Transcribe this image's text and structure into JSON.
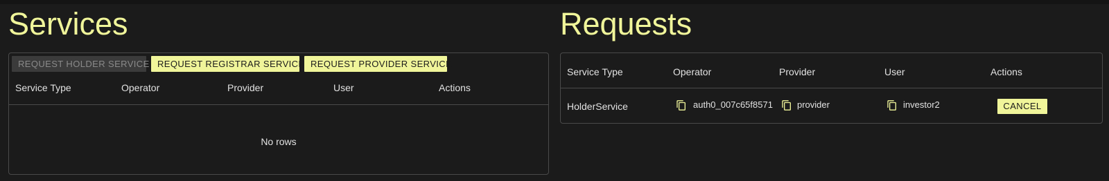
{
  "services": {
    "title": "Services",
    "buttons": {
      "holder": "REQUEST HOLDER SERVICE",
      "registrar": "REQUEST REGISTRAR SERVICE",
      "provider": "REQUEST PROVIDER SERVICE"
    },
    "columns": [
      "Service Type",
      "Operator",
      "Provider",
      "User",
      "Actions"
    ],
    "empty_text": "No rows"
  },
  "requests": {
    "title": "Requests",
    "columns": [
      "Service Type",
      "Operator",
      "Provider",
      "User",
      "Actions"
    ],
    "rows": [
      {
        "service_type": "HolderService",
        "operator": "auth0_007c65f8571",
        "provider": "provider",
        "user": "investor2",
        "action": "CANCEL"
      }
    ]
  },
  "colors": {
    "accent": "#f0f59a",
    "background": "#1b1b1b",
    "border": "#4a4a4a",
    "disabled_button": "#3b3b3b"
  },
  "icons": {
    "copy": "copy-icon"
  }
}
